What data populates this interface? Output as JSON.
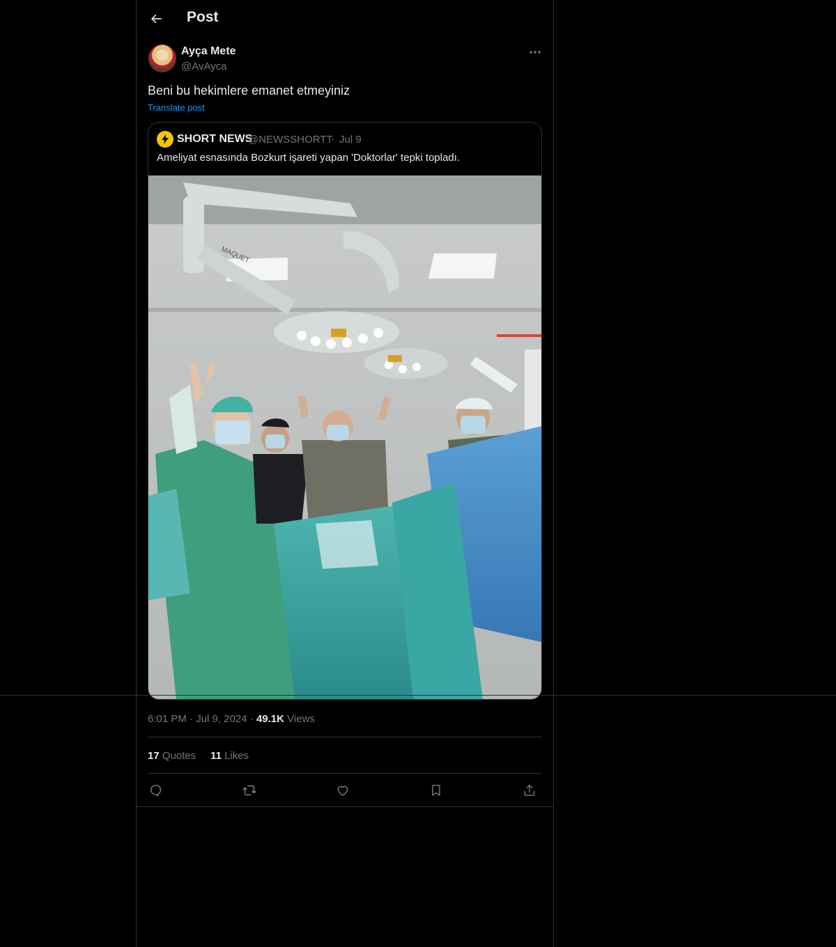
{
  "header": {
    "title": "Post"
  },
  "post": {
    "author_name": "Ayça Mete",
    "author_handle": "@AvAyca",
    "text": "Beni bu hekimlere emanet etmeyiniz",
    "translate_label": "Translate post",
    "time": "6:01 PM",
    "date": "Jul 9, 2024",
    "views_count": "49.1K",
    "views_label": "Views",
    "quotes_count": "17",
    "quotes_label": "Quotes",
    "likes_count": "11",
    "likes_label": "Likes"
  },
  "quoted": {
    "name": "SHORT NEWS",
    "handle": "@NEWSSHORTT",
    "date": "Jul 9",
    "text": "Ameliyat esnasında Bozkurt işareti yapan 'Doktorlar' tepki topladı.",
    "lamp_label": "MAQUET"
  },
  "icons": {
    "back": "back-arrow-icon",
    "more": "more-icon",
    "reply": "reply-icon",
    "repost": "repost-icon",
    "like": "like-icon",
    "bookmark": "bookmark-icon",
    "share": "share-icon"
  },
  "colors": {
    "background": "#000000",
    "text": "#e7e9ea",
    "muted": "#71767b",
    "accent": "#1d9bf0",
    "border": "#2f3336"
  }
}
